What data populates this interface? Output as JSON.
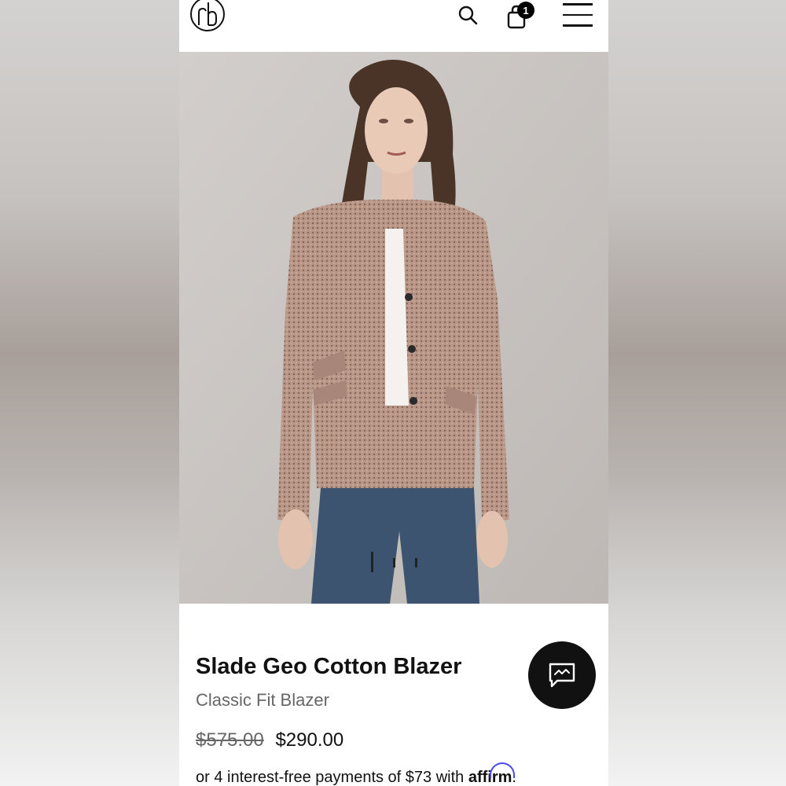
{
  "header": {
    "logo_icon": "rb-monogram-icon",
    "search_icon": "search-icon",
    "cart_icon": "shopping-bag-icon",
    "cart_count": "1",
    "menu_icon": "hamburger-menu-icon"
  },
  "gallery": {
    "image_description_icon": "product-photo",
    "indicator_count": 3,
    "active_index": 0
  },
  "product": {
    "title": "Slade Geo Cotton Blazer",
    "subtitle": "Classic Fit Blazer",
    "price_original": "$575.00",
    "price_sale": "$290.00",
    "financing_text": "or 4 interest-free payments of $73 with ",
    "financing_brand": "affirm",
    "financing_suffix": "."
  },
  "chat": {
    "icon": "chat-icon"
  },
  "colors": {
    "text_primary": "#111111",
    "text_secondary": "#666666",
    "affirm_blue": "#4a4af4",
    "chat_bg": "#111111"
  }
}
